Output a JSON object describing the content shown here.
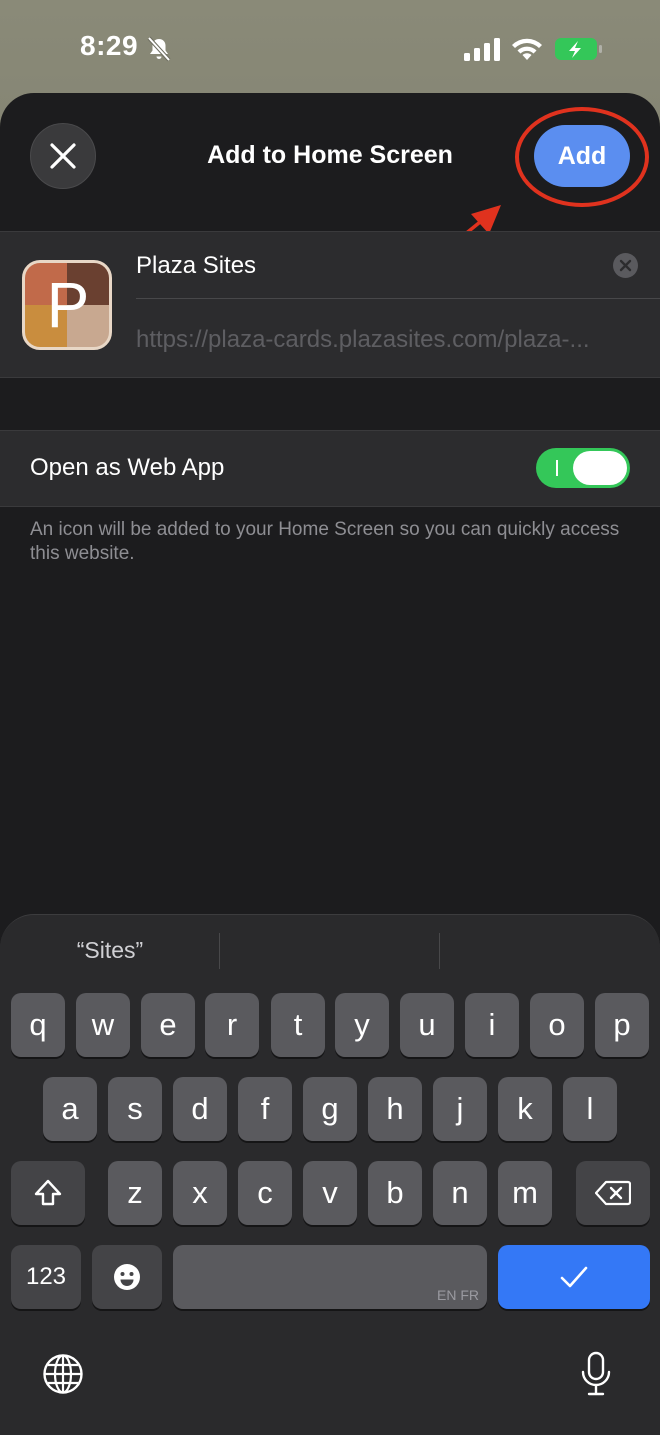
{
  "status_bar": {
    "time": "8:29",
    "icons": [
      "bell-slash-icon",
      "cellular-signal-icon",
      "wifi-icon",
      "battery-charging-icon"
    ]
  },
  "sheet": {
    "title": "Add to Home Screen",
    "close_icon": "close-icon",
    "add_label": "Add"
  },
  "site": {
    "icon_letter": "P",
    "name": "Plaza Sites",
    "url": "https://plaza-cards.plazasites.com/plaza-..."
  },
  "web_app": {
    "label": "Open as Web App",
    "enabled": true
  },
  "hint": "An icon will be added to your Home Screen so you can quickly access this website.",
  "keyboard": {
    "suggestions": [
      "“Sites”",
      "",
      ""
    ],
    "row1": [
      "q",
      "w",
      "e",
      "r",
      "t",
      "y",
      "u",
      "i",
      "o",
      "p"
    ],
    "row2": [
      "a",
      "s",
      "d",
      "f",
      "g",
      "h",
      "j",
      "k",
      "l"
    ],
    "row3": [
      "z",
      "x",
      "c",
      "v",
      "b",
      "n",
      "m"
    ],
    "numbers_label": "123",
    "space_languages": "EN FR",
    "return_icon": "checkmark-icon"
  },
  "colors": {
    "accent_blue": "#5b8ef0",
    "toggle_green": "#34c759",
    "annotation_red": "#e0321e",
    "sheet_bg": "#1c1c1e"
  }
}
